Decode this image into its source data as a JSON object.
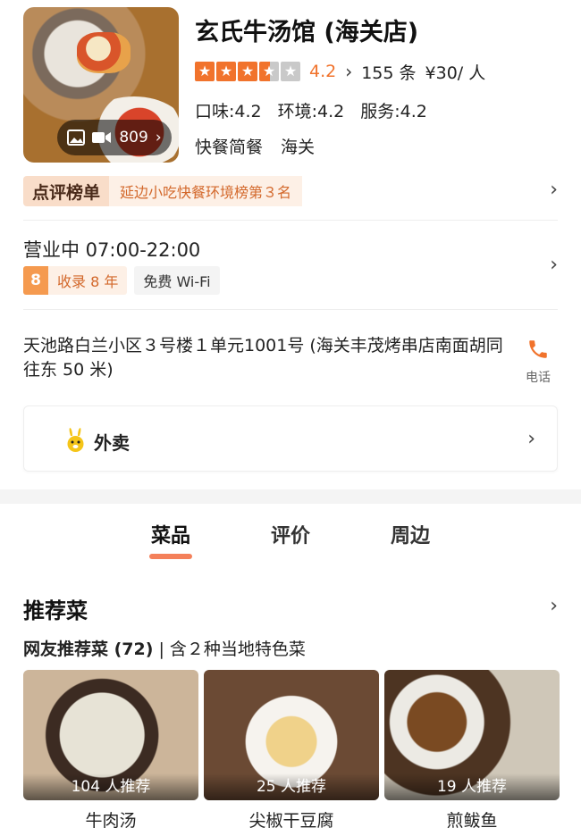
{
  "shop": {
    "name": "玄氏牛汤馆 (海关店)",
    "rating": "4.2",
    "reviews": "155 条",
    "price": "¥30/ 人",
    "scores": {
      "taste": "口味:4.2",
      "env": "环境:4.2",
      "service": "服务:4.2"
    },
    "tags": [
      "快餐简餐",
      "海关"
    ],
    "photo_count": "809"
  },
  "ranking": {
    "badge": "点评榜单",
    "text": "延边小吃快餐环境榜第３名"
  },
  "hours": {
    "status": "营业中 07:00-22:00",
    "years_num": "8",
    "years_text": "收录 8 年",
    "wifi": "免费 Wi-Fi"
  },
  "address": {
    "text": "天池路白兰小区３号楼１单元1001号 (海关丰茂烤串店南面胡同往东 50 米)",
    "phone_label": "电话"
  },
  "takeout": {
    "label": "外卖"
  },
  "tabs": [
    "菜品",
    "评价",
    "周边"
  ],
  "recommend": {
    "title": "推荐菜",
    "sub_bold": "网友推荐菜 (72)",
    "sub_rest": " | 含２种当地特色菜",
    "dishes": [
      {
        "count": "104 人推荐",
        "name": "牛肉汤"
      },
      {
        "count": "25 人推荐",
        "name": "尖椒干豆腐"
      },
      {
        "count": "19 人推荐",
        "name": "煎鲅鱼"
      }
    ]
  },
  "colors": {
    "accent": "#f1732c",
    "tab_underline": "#f26a3d"
  }
}
